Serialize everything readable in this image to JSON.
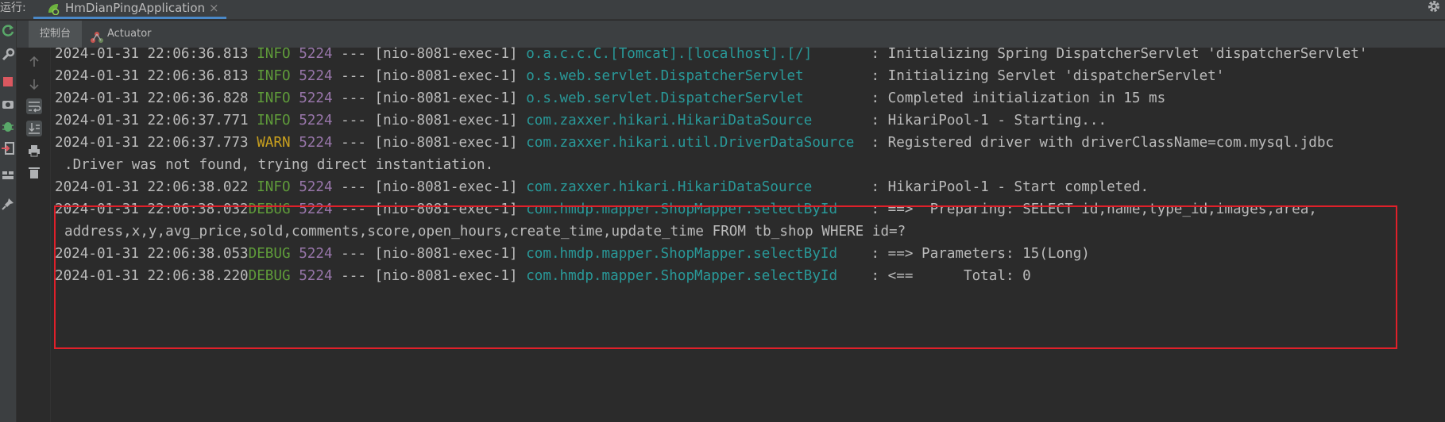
{
  "window": {
    "run_label": "运行:",
    "tab_title": "HmDianPingApplication",
    "tab_close": "×"
  },
  "subtabs": {
    "console": "控制台",
    "actuator": "Actuator"
  },
  "colors": {
    "info": "#5f9b3a",
    "warn": "#c9a01e",
    "pid": "#9876aa",
    "logger": "#299999",
    "highlight_border": "#e0202a"
  },
  "log": {
    "lines": [
      {
        "ts": "2024-01-31 22:06:36.813",
        "level": " INFO",
        "pid": "5224",
        "thread": " --- [nio-8081-exec-1] ",
        "logger": "o.a.c.c.C.[Tomcat].[localhost].[/]      ",
        "msg": " : Initializing Spring DispatcherServlet 'dispatcherServlet'"
      },
      {
        "ts": "2024-01-31 22:06:36.813",
        "level": " INFO",
        "pid": "5224",
        "thread": " --- [nio-8081-exec-1] ",
        "logger": "o.s.web.servlet.DispatcherServlet       ",
        "msg": " : Initializing Servlet 'dispatcherServlet'"
      },
      {
        "ts": "2024-01-31 22:06:36.828",
        "level": " INFO",
        "pid": "5224",
        "thread": " --- [nio-8081-exec-1] ",
        "logger": "o.s.web.servlet.DispatcherServlet       ",
        "msg": " : Completed initialization in 15 ms"
      },
      {
        "ts": "2024-01-31 22:06:37.771",
        "level": " INFO",
        "pid": "5224",
        "thread": " --- [nio-8081-exec-1] ",
        "logger": "com.zaxxer.hikari.HikariDataSource      ",
        "msg": " : HikariPool-1 - Starting..."
      },
      {
        "ts": "2024-01-31 22:06:37.773",
        "level": " WARN",
        "pid": "5224",
        "thread": " --- [nio-8081-exec-1] ",
        "logger": "com.zaxxer.hikari.util.DriverDataSource ",
        "msg": " : Registered driver with driverClassName=com.mysql.jdbc"
      },
      {
        "ts": "2024-01-31 22:06:38.022",
        "level": " INFO",
        "pid": "5224",
        "thread": " --- [nio-8081-exec-1] ",
        "logger": "com.zaxxer.hikari.HikariDataSource      ",
        "msg": " : HikariPool-1 - Start completed."
      },
      {
        "ts": "2024-01-31 22:06:38.032",
        "level": "DEBUG",
        "pid": "5224",
        "thread": " --- [nio-8081-exec-1] ",
        "logger": "com.hmdp.mapper.ShopMapper.selectById   ",
        "msg": " : ==>  Preparing: SELECT id,name,type_id,images,area,"
      },
      {
        "ts": "2024-01-31 22:06:38.053",
        "level": "DEBUG",
        "pid": "5224",
        "thread": " --- [nio-8081-exec-1] ",
        "logger": "com.hmdp.mapper.ShopMapper.selectById   ",
        "msg": " : ==> Parameters: 15(Long)"
      },
      {
        "ts": "2024-01-31 22:06:38.220",
        "level": "DEBUG",
        "pid": "5224",
        "thread": " --- [nio-8081-exec-1] ",
        "logger": "com.hmdp.mapper.ShopMapper.selectById   ",
        "msg": " : <==      Total: 0"
      }
    ],
    "wrap_driver": ".Driver was not found, trying direct instantiation.",
    "wrap_sql": "address,x,y,avg_price,sold,comments,score,open_hours,create_time,update_time FROM tb_shop WHERE id=?"
  }
}
